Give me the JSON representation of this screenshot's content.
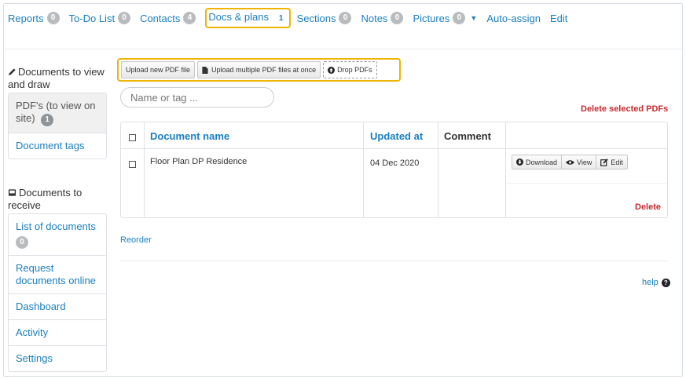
{
  "nav": {
    "items": [
      {
        "label": "Reports",
        "badge": "0"
      },
      {
        "label": "To-Do List",
        "badge": "0"
      },
      {
        "label": "Contacts",
        "badge": "4"
      },
      {
        "label": "Docs & plans",
        "badge": "1"
      },
      {
        "label": "Sections",
        "badge": "0"
      },
      {
        "label": "Notes",
        "badge": "0"
      },
      {
        "label": "Pictures",
        "badge": "0"
      },
      {
        "label": "Auto-assign"
      },
      {
        "label": "Edit"
      }
    ]
  },
  "sidebar": {
    "view_heading": "Documents to view and draw",
    "view_items": [
      {
        "label": "PDF's (to view on site)",
        "badge": "1"
      },
      {
        "label": "Document tags"
      }
    ],
    "receive_heading": "Documents to receive",
    "receive_items": [
      {
        "label": "List of documents",
        "badge": "0"
      },
      {
        "label": "Request documents online"
      },
      {
        "label": "Dashboard"
      },
      {
        "label": "Activity"
      },
      {
        "label": "Settings"
      }
    ]
  },
  "toolbar": {
    "upload_new": "Upload new PDF file",
    "upload_multiple": "Upload multiple PDF files at once",
    "drop": "Drop PDFs"
  },
  "search": {
    "placeholder": "Name or tag ..."
  },
  "delete_selected": "Delete selected PDFs",
  "table": {
    "headers": {
      "name": "Document name",
      "updated": "Updated at",
      "comment": "Comment"
    },
    "rows": [
      {
        "name": "Floor Plan DP Residence",
        "updated": "04 Dec 2020",
        "comment": "",
        "actions": {
          "download": "Download",
          "view": "View",
          "edit": "Edit"
        },
        "delete": "Delete"
      }
    ]
  },
  "reorder": "Reorder",
  "help": "help",
  "colors": {
    "link": "#1a7fc1",
    "highlight": "#f0b400",
    "danger": "#c62b30",
    "badge": "#b9bcbf"
  }
}
